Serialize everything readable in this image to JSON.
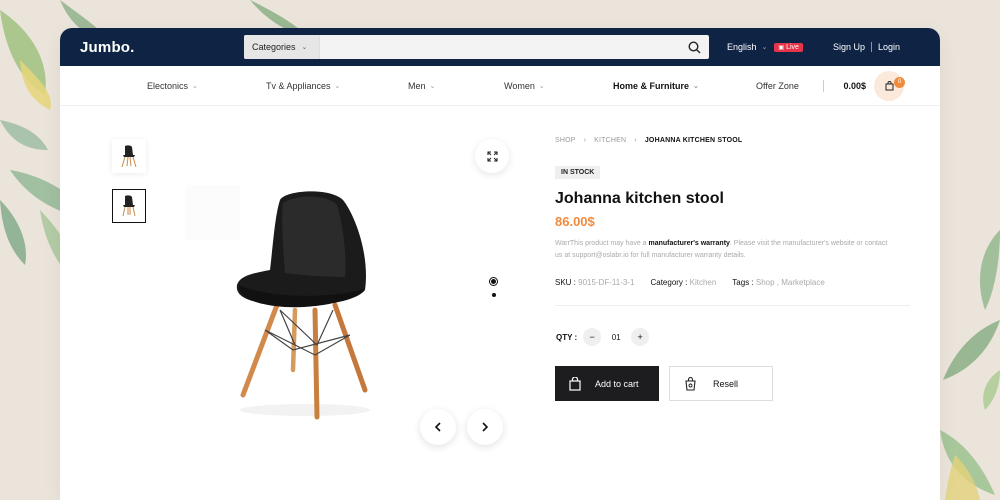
{
  "brand": {
    "logo": "Jumbo."
  },
  "search": {
    "category_label": "Categories",
    "placeholder": ""
  },
  "topbar": {
    "language": "English",
    "live_badge": "Live",
    "signup": "Sign Up",
    "login": "Login"
  },
  "nav": {
    "items": [
      {
        "label": "Electonics"
      },
      {
        "label": "Tv & Appliances"
      },
      {
        "label": "Men"
      },
      {
        "label": "Women"
      },
      {
        "label": "Home & Furniture"
      },
      {
        "label": "Offer Zone"
      }
    ],
    "cart_total": "0.00$",
    "cart_count": "0"
  },
  "breadcrumb": {
    "items": [
      "SHOP",
      "KITCHEN"
    ],
    "current": "JOHANNA KITCHEN STOOL"
  },
  "product": {
    "stock": "IN STOCK",
    "title": "Johanna kitchen stool",
    "price": "86.00$",
    "warranty_pre": "WarrThis product may have a ",
    "warranty_bold": "manufacturer's warranty",
    "warranty_post": ". Please visit the manufacturer's website or contact us at support@oslabr.io for full manufacturer warranty details.",
    "sku_label": "SKU :",
    "sku": "9015-DF-11-3-1",
    "category_label": "Category :",
    "category": "Kitchen",
    "tags_label": "Tags :",
    "tags": "Shop , Marketplace"
  },
  "qty": {
    "label": "QTY :",
    "value": "01",
    "minus": "−",
    "plus": "+"
  },
  "actions": {
    "add_to_cart": "Add to cart",
    "resell": "Resell"
  },
  "colors": {
    "topbar": "#0f2445",
    "accent": "#f28a3c",
    "live": "#e8344a",
    "dark_button": "#1d1d1f"
  },
  "icons": [
    "search-icon",
    "chevron-down-icon",
    "cart-icon",
    "expand-icon",
    "arrow-left-icon",
    "arrow-right-icon",
    "shopping-bag-icon",
    "gift-bag-icon"
  ]
}
